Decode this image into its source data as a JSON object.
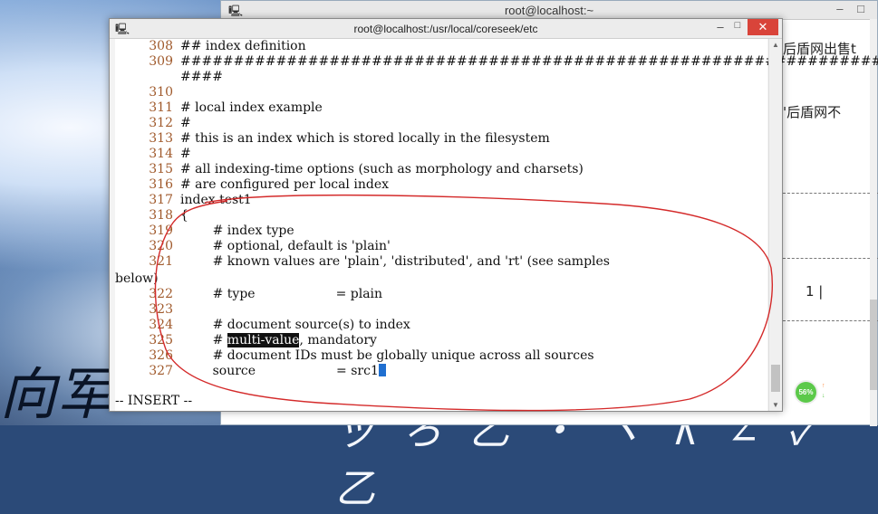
{
  "wallpaper": {
    "text_left": "向军",
    "text_bottom": "ッ ろ 乙 ・ ヽ ∧ ∠ ✓ 乙"
  },
  "background_window": {
    "title": "root@localhost:~",
    "visible_lines": [
      "后盾网出售t",
      "'后盾网不",
      "1 |"
    ],
    "controls": "– □"
  },
  "main_window": {
    "title": "root@localhost:/usr/local/coreseek/etc",
    "controls": {
      "minimize": "–",
      "maximize": "□",
      "close": "✕"
    }
  },
  "editor": {
    "lines": [
      {
        "num": "308",
        "text": "## index definition"
      },
      {
        "num": "309",
        "text": "##################################################################"
      },
      {
        "num": "",
        "text": "####"
      },
      {
        "num": "310",
        "text": ""
      },
      {
        "num": "311",
        "text": "# local index example"
      },
      {
        "num": "312",
        "text": "#"
      },
      {
        "num": "313",
        "text": "# this is an index which is stored locally in the filesystem"
      },
      {
        "num": "314",
        "text": "#"
      },
      {
        "num": "315",
        "text": "# all indexing-time options (such as morphology and charsets)"
      },
      {
        "num": "316",
        "text": "# are configured per local index"
      },
      {
        "num": "317",
        "text": "index test1"
      },
      {
        "num": "318",
        "text": "{"
      },
      {
        "num": "319",
        "text": "        # index type"
      },
      {
        "num": "320",
        "text": "        # optional, default is 'plain'"
      },
      {
        "num": "321",
        "text": "        # known values are 'plain', 'distributed', and 'rt' (see samples"
      },
      {
        "num": "",
        "text": "below)"
      },
      {
        "num": "322",
        "text": "        # type                    = plain"
      },
      {
        "num": "323",
        "text": ""
      },
      {
        "num": "324",
        "text": "        # document source(s) to index"
      },
      {
        "num": "325",
        "text_before": "        # ",
        "selected": "multi-value",
        "text_after": ", mandatory"
      },
      {
        "num": "326",
        "text": "        # document IDs must be globally unique across all sources"
      },
      {
        "num": "327",
        "text": "        source                    = src1"
      }
    ],
    "mode": "-- INSERT --"
  },
  "network": {
    "percent": "56%",
    "upload": "0.02K/S",
    "download": "0K/S"
  },
  "colors": {
    "line_numbers": "#a05a2c",
    "close_button": "#d9443a",
    "annotation": "#d42a2a",
    "cursor": "#1f6fd0"
  }
}
